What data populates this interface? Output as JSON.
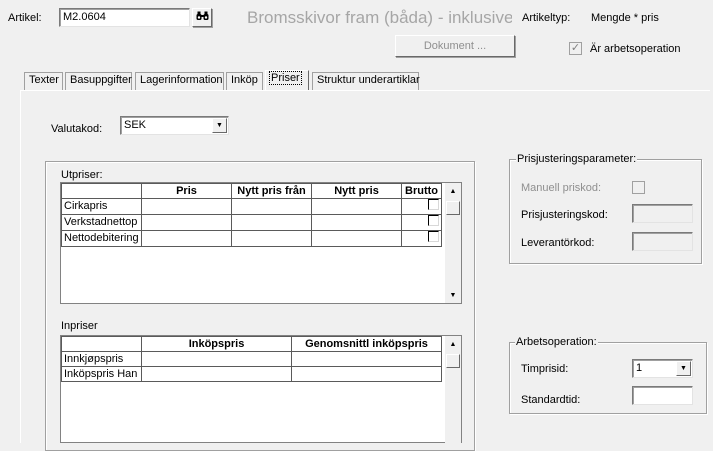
{
  "header": {
    "artikel_label": "Artikel:",
    "artikel_value": "M2.0604",
    "search_icon": "binoculars-icon",
    "description": "Bromsskivor fram (båda) - inklusive be",
    "artikeltyp_label": "Artikeltyp:",
    "artikeltyp_value": "Mengde * pris",
    "dokument_button": "Dokument ...",
    "arbetsoperation_label": "Är arbetsoperation",
    "arbetsoperation_checked": true
  },
  "tabs": [
    {
      "label": "Texter"
    },
    {
      "label": "Basuppgifter"
    },
    {
      "label": "Lagerinformation"
    },
    {
      "label": "Inköp"
    },
    {
      "label": "Priser",
      "active": true
    },
    {
      "label": "Struktur underartiklar"
    }
  ],
  "priser": {
    "valutakod_label": "Valutakod:",
    "valutakod_value": "SEK",
    "utpriser": {
      "title": "Utpriser:",
      "columns": [
        "Pris",
        "Nytt pris från",
        "Nytt pris",
        "Brutto"
      ],
      "rows": [
        {
          "label": "Cirkapris"
        },
        {
          "label": "Verkstadnettop"
        },
        {
          "label": "Nettodebitering"
        }
      ]
    },
    "inpriser": {
      "title": "Inpriser",
      "columns": [
        "Inköpspris",
        "Genomsnittl inköpspris"
      ],
      "rows": [
        {
          "label": "Innkjøpspris"
        },
        {
          "label": "Inköpspris Han"
        }
      ]
    },
    "prisjustering": {
      "title": "Prisjusteringsparameter:",
      "manuell_label": "Manuell priskod:",
      "prisjusteringskod_label": "Prisjusteringskod:",
      "leverantorkod_label": "Leverantörkod:"
    },
    "arbetsoperation": {
      "title": "Arbetsoperation:",
      "timprisid_label": "Timprisid:",
      "timprisid_value": "1",
      "standardtid_label": "Standardtid:"
    }
  }
}
